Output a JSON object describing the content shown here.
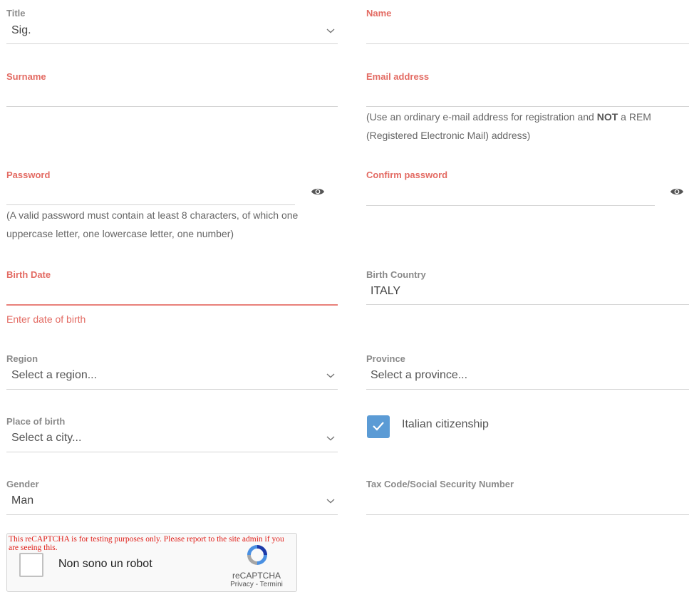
{
  "title_field": {
    "label": "Title",
    "value": "Sig."
  },
  "name_field": {
    "label": "Name",
    "value": ""
  },
  "surname_field": {
    "label": "Surname",
    "value": ""
  },
  "email_field": {
    "label": "Email address",
    "value": "",
    "hint_pre": "(Use an ordinary e-mail address for registration and ",
    "hint_bold": "NOT",
    "hint_post": " a REM (Registered Electronic Mail) address)"
  },
  "password_field": {
    "label": "Password",
    "value": "",
    "hint": "(A valid password must contain at least 8 characters, of which one uppercase letter, one lowercase letter, one number)"
  },
  "confirm_password_field": {
    "label": "Confirm password",
    "value": ""
  },
  "birth_date_field": {
    "label": "Birth Date",
    "value": "",
    "error": "Enter date of birth"
  },
  "birth_country_field": {
    "label": "Birth Country",
    "value": "ITALY"
  },
  "region_field": {
    "label": "Region",
    "placeholder": "Select a region..."
  },
  "province_field": {
    "label": "Province",
    "placeholder": "Select a province..."
  },
  "place_of_birth_field": {
    "label": "Place of birth",
    "placeholder": "Select a city..."
  },
  "citizenship": {
    "label": "Italian citizenship",
    "checked": true
  },
  "gender_field": {
    "label": "Gender",
    "value": "Man"
  },
  "tax_code_field": {
    "label": "Tax Code/Social Security Number",
    "value": ""
  },
  "recaptcha": {
    "warning": "This reCAPTCHA is for testing purposes only. Please report to the site admin if you are seeing this.",
    "label": "Non sono un robot",
    "brand": "reCAPTCHA",
    "links": "Privacy - Termini"
  },
  "colors": {
    "required_label": "#e36b63",
    "optional_label": "#8a8a8a",
    "checkbox": "#5b9bd5",
    "recaptcha_warning": "#e0201a"
  },
  "icons": {
    "dropdown": "chevron-down-icon",
    "password_toggle": "eye-icon",
    "checkbox": "checkmark-icon",
    "recaptcha": "recaptcha-logo-icon"
  }
}
